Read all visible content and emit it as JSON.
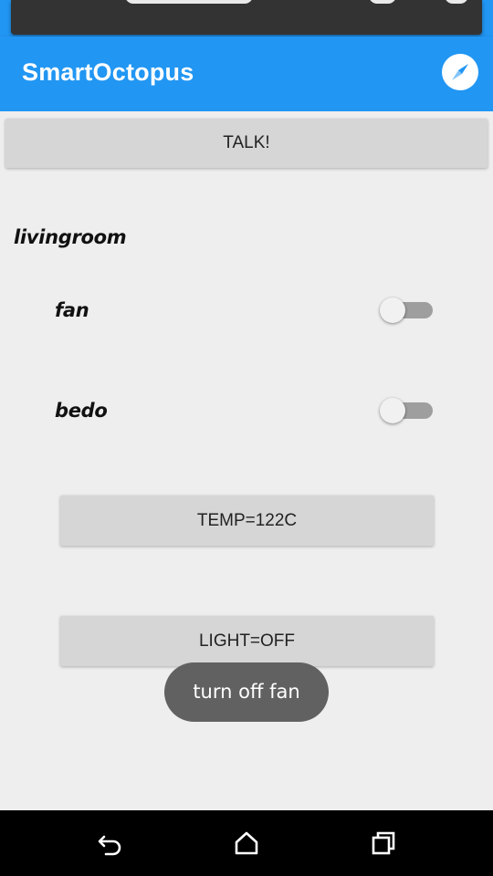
{
  "app": {
    "title": "SmartOctopus",
    "accent_color": "#2196f3",
    "header_icon": "compass-icon"
  },
  "talk_button": {
    "label": "TALK!"
  },
  "room": {
    "label": "livingroom",
    "devices": [
      {
        "label": "fan",
        "on": false
      },
      {
        "label": "bedo",
        "on": false
      }
    ]
  },
  "readings": {
    "temp_label": "TEMP=122C",
    "light_label": "LIGHT=OFF"
  },
  "toast": {
    "text": "turn off fan"
  },
  "navbar": {
    "icons": [
      "back-icon",
      "home-icon",
      "recents-icon"
    ]
  }
}
